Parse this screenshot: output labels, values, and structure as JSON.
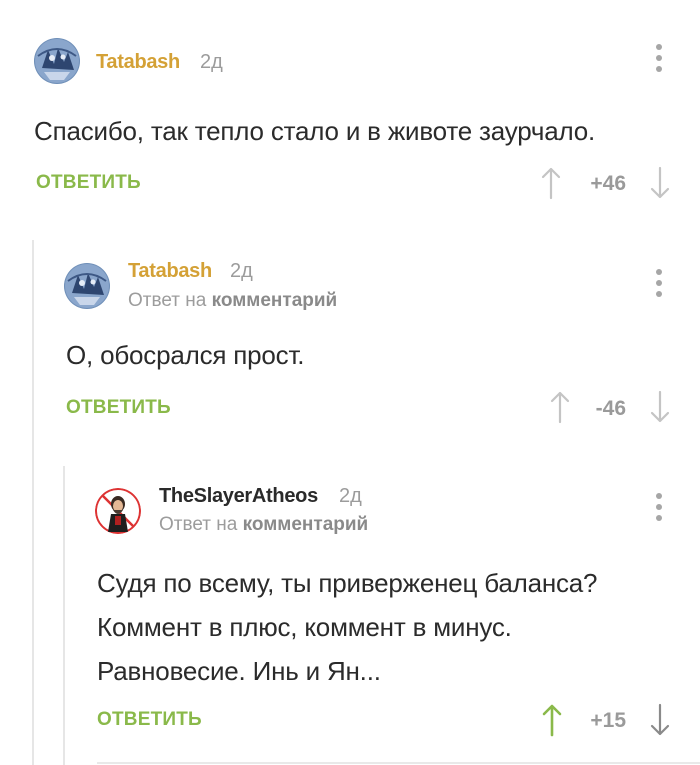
{
  "comments": [
    {
      "username": "Tatabash",
      "age": "2д",
      "text": "Спасибо, так тепло стало и в животе заурчало.",
      "reply_label": "ОТВЕТИТЬ",
      "score": "+46",
      "username_color": "#d4a136",
      "upvoted": false
    },
    {
      "username": "Tatabash",
      "age": "2д",
      "reply_to_prefix": "Ответ на",
      "reply_to_target": "комментарий",
      "text": "О, обосрался прост.",
      "reply_label": "ОТВЕТИТЬ",
      "score": "-46",
      "username_color": "#d4a136",
      "upvoted": false
    },
    {
      "username": "TheSlayerAtheos",
      "age": "2д",
      "reply_to_prefix": "Ответ на",
      "reply_to_target": "комментарий",
      "text_lines": [
        "Судя по всему, ты приверженец баланса?",
        "Коммент в плюс, коммент в минус.",
        "Равновесие. Инь и Ян..."
      ],
      "reply_label": "ОТВЕТИТЬ",
      "score": "+15",
      "username_color": "#2a2a2a",
      "upvoted": true
    }
  ],
  "colors": {
    "accent_green": "#8ab94a",
    "muted_gray": "#a6a6a6",
    "thread_line": "#e6e6e6"
  },
  "icons": {
    "upvote": "arrow-up-icon",
    "downvote": "arrow-down-icon",
    "more": "more-vertical-icon"
  }
}
